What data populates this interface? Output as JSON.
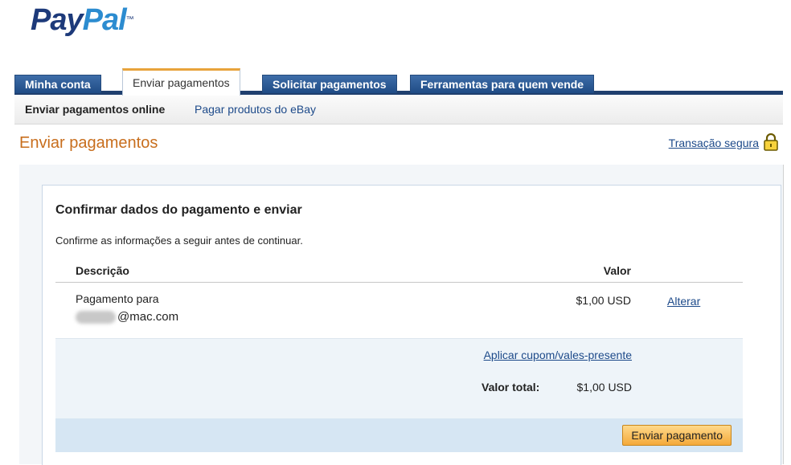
{
  "brand": {
    "pay": "Pay",
    "pal": "Pal",
    "tm": "™"
  },
  "tabs": [
    {
      "label": "Minha conta"
    },
    {
      "label": "Enviar pagamentos"
    },
    {
      "label": "Solicitar pagamentos"
    },
    {
      "label": "Ferramentas para quem vende"
    }
  ],
  "subnav": [
    {
      "label": "Enviar pagamentos online"
    },
    {
      "label": "Pagar produtos do eBay"
    }
  ],
  "page": {
    "title": "Enviar pagamentos",
    "secure_link": "Transação segura"
  },
  "card": {
    "title": "Confirmar dados do pagamento e enviar",
    "subtitle": "Confirme as informações a seguir antes de continuar.",
    "col_description": "Descrição",
    "col_value": "Valor",
    "payment_to_label": "Pagamento para",
    "email_suffix": "@mac.com",
    "amount": "$1,00 USD",
    "change_link": "Alterar",
    "coupon_link": "Aplicar cupom/vales-presente",
    "total_label": "Valor total:",
    "total_value": "$1,00 USD",
    "send_button": "Enviar pagamento"
  },
  "colors": {
    "brand_dark": "#1d3a7a",
    "brand_light": "#2c8cd0",
    "title_orange": "#c86e1d",
    "link": "#1d4a8a"
  }
}
